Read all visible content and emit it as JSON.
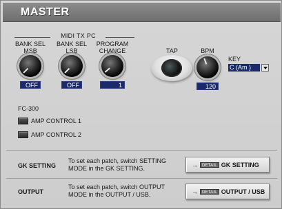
{
  "header": {
    "title": "MASTER"
  },
  "midi_tx_pc": {
    "group_label": "MIDI TX PC",
    "bank_sel_msb": {
      "label_line1": "BANK SEL",
      "label_line2": "MSB",
      "value": "OFF"
    },
    "bank_sel_lsb": {
      "label_line1": "BANK SEL",
      "label_line2": "LSB",
      "value": "OFF"
    },
    "program_change": {
      "label_line1": "PROGRAM",
      "label_line2": "CHANGE",
      "value": "1"
    }
  },
  "tap": {
    "label": "TAP"
  },
  "bpm": {
    "label": "BPM",
    "value": "120"
  },
  "key": {
    "label": "KEY",
    "value": "C (Am )"
  },
  "fc300": {
    "label": "FC-300",
    "amp_control_1": "AMP CONTROL 1",
    "amp_control_2": "AMP CONTROL 2"
  },
  "gk_setting": {
    "title": "GK SETTING",
    "description_line1": "To set each patch, switch SETTING",
    "description_line2": "MODE in the GK SETTING.",
    "button_arrow": "→",
    "button_tag": "DETAIL",
    "button_label": "GK SETTING"
  },
  "output": {
    "title": "OUTPUT",
    "description_line1": "To set each patch, switch OUTPUT",
    "description_line2": "MODE in the OUTPUT / USB.",
    "button_arrow": "→",
    "button_tag": "DETAIL",
    "button_label": "OUTPUT / USB"
  },
  "colors": {
    "value_box_bg": "#1a2a6a",
    "header_bg": "#7d7d7d",
    "panel_bg": "#d2d2d2"
  }
}
